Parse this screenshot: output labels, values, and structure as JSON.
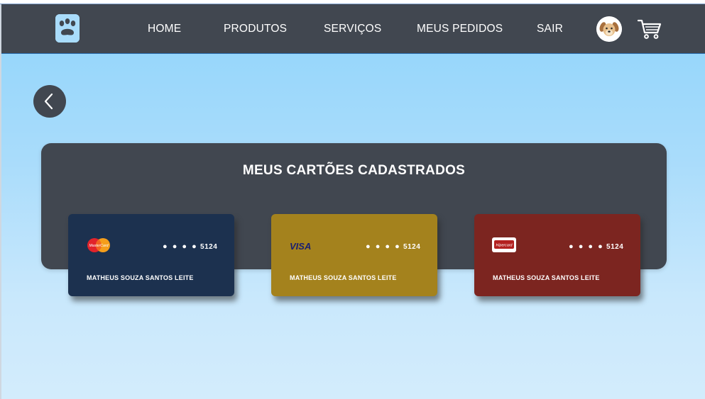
{
  "nav": {
    "links": [
      "HOME",
      "PRODUTOS",
      "SERVIÇOS",
      "MEUS PEDIDOS",
      "SAIR"
    ],
    "logo_icon": "paw-icon",
    "avatar_icon": "dog-avatar-icon",
    "cart_icon": "shopping-cart-icon"
  },
  "back": {
    "icon": "chevron-left-icon"
  },
  "panel": {
    "title": "MEUS CARTÕES CADASTRADOS"
  },
  "cards": [
    {
      "brand": "MasterCard",
      "brand_icon": "mastercard-icon",
      "masked": "● ● ● ●",
      "last4": "5124",
      "holder": "MATHEUS SOUZA SANTOS LEITE",
      "color": "#1c314f"
    },
    {
      "brand": "VISA",
      "brand_icon": "visa-icon",
      "masked": "● ● ● ●",
      "last4": "5124",
      "holder": "MATHEUS SOUZA SANTOS LEITE",
      "color": "#a4821d"
    },
    {
      "brand": "Hipercard",
      "brand_icon": "hipercard-icon",
      "masked": "● ● ● ●",
      "last4": "5124",
      "holder": "MATHEUS SOUZA SANTOS LEITE",
      "color": "#7c2520"
    }
  ],
  "colors": {
    "navbar": "#414750",
    "background": "#a9dcfb",
    "panel": "#414750"
  }
}
